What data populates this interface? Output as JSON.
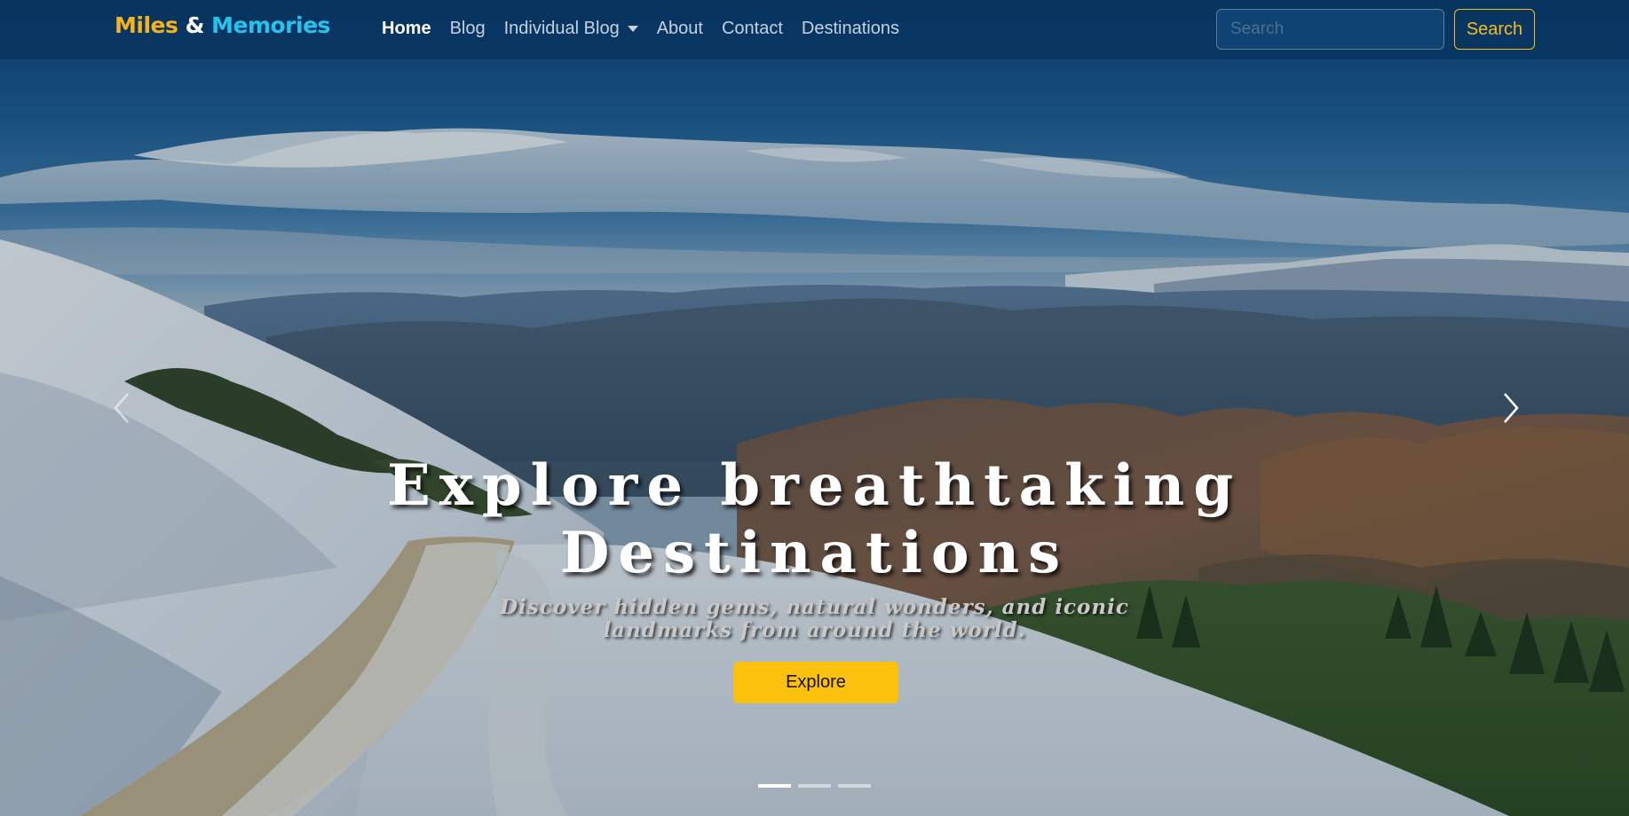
{
  "brand": {
    "part1": "Miles",
    "part2": "&",
    "part3": "Memories"
  },
  "nav": {
    "items": [
      {
        "label": "Home",
        "active": true
      },
      {
        "label": "Blog",
        "active": false
      },
      {
        "label": "Individual Blog",
        "active": false,
        "dropdown": true
      },
      {
        "label": "About",
        "active": false
      },
      {
        "label": "Contact",
        "active": false
      },
      {
        "label": "Destinations",
        "active": false
      }
    ]
  },
  "search": {
    "placeholder": "Search",
    "button_label": "Search"
  },
  "hero": {
    "headline_line1": "Explore breathtaking",
    "headline_line2": "Destinations",
    "subline_line1": "Discover hidden gems, natural wonders, and iconic",
    "subline_line2": "landmarks from around the world.",
    "cta_label": "Explore"
  },
  "carousel": {
    "slide_count": 3,
    "active_index": 0
  },
  "colors": {
    "navbar": "#083460",
    "brand_accent_1": "#f7b41a",
    "brand_accent_2": "#25c4ee",
    "cta": "#fcc10d",
    "search_outline": "#f5bd1f"
  },
  "icons": {
    "prev": "chevron-left-icon",
    "next": "chevron-right-icon",
    "dropdown": "caret-down-icon"
  }
}
